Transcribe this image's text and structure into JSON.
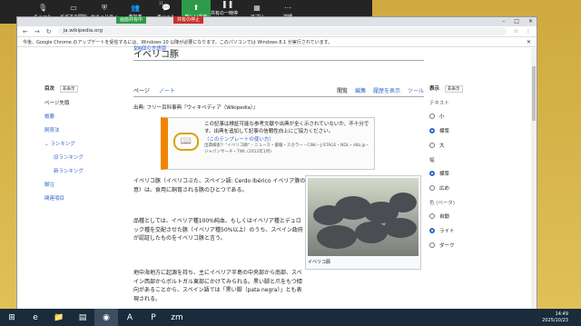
{
  "zoom": {
    "items": [
      {
        "label": "ミュート",
        "icon": "microphone-icon"
      },
      {
        "label": "ビデオの開始",
        "icon": "video-icon"
      },
      {
        "label": "セキュリティ",
        "icon": "shield-icon"
      },
      {
        "label": "参加者",
        "icon": "participants-icon",
        "count": "11"
      },
      {
        "label": "チャット",
        "icon": "chat-icon"
      },
      {
        "label": "新しい共有",
        "icon": "share-icon"
      },
      {
        "label": "共有の一時停止",
        "icon": "pause-icon"
      },
      {
        "label": "アプリ",
        "icon": "apps-icon"
      },
      {
        "label": "詳細",
        "icon": "more-icon"
      }
    ],
    "sharing_text": "画面共有中",
    "stop_text": "共有の停止"
  },
  "browser": {
    "url": "ja.wikipedia.org",
    "infobar": "今後、Google Chrome のアップデートを受信するには、Windows 10 以降が必要になります。このパソコンでは Windows 8.1 が実行されています。"
  },
  "article": {
    "title": "イベリコ豚",
    "langs": "17 個の言語版",
    "toc_title": "目次",
    "hide": "非表示",
    "toc": [
      {
        "label": "ページ先頭",
        "level": "top"
      },
      {
        "label": "概要",
        "level": "1"
      },
      {
        "label": "飼育法",
        "level": "1"
      },
      {
        "label": "ランキング",
        "level": "1"
      },
      {
        "label": "旧ランキング",
        "level": "2"
      },
      {
        "label": "新ランキング",
        "level": "2"
      },
      {
        "label": "脚注",
        "level": "1"
      },
      {
        "label": "関連項目",
        "level": "1"
      }
    ],
    "tab_page": "ページ",
    "tab_talk": "ノート",
    "tab_read": "閲覧",
    "tab_edit": "編集",
    "tab_history": "履歴を表示",
    "tab_tools": "ツール",
    "from": "出典: フリー百科事典『ウィキペディア（Wikipedia）』",
    "ambox_main": "この記事は検証可能な参考文献や出典が全く示されていないか、不十分です。出典を追加して記事の信頼性向上にご協力ください。",
    "ambox_how": "（このテンプレートの使い方）",
    "ambox_src": "出典検索?: \"イベリコ豚\" – ニュース・書籍・スカラー・CiNii・J-STAGE・NDL・dlib.jp・ジャパンサーチ・TWL (2012年1月)",
    "para1": "イベリコ豚（イベリコぶた、スペイン語: Cerdo Ibérico イベリア豚の意）は、食用に飼育される豚のひとつである。",
    "para2": "品種としては、イベリア種100%純血、もしくはイベリア種とデュロック種を交配させた豚（イベリア種50%以上）のうち、スペイン政府が認証したものをイベリコ豚と言う。",
    "para3": "地中海地方に起源を持ち、主にイベリア半島の中央部から南部、スペイン西部からポルトガル東部にかけてみられる。黒い脚と爪をもつ傾向があることから、スペイン語では「黒い脚（pata negra）」とも表現される。",
    "caption": "イベリコ豚"
  },
  "appearance": {
    "title": "表示",
    "hide": "非表示",
    "text_heading": "テキスト",
    "text_options": [
      "小",
      "標準",
      "大"
    ],
    "width_heading": "幅",
    "width_options": [
      "標準",
      "広め"
    ],
    "color_heading": "色 (ベータ)",
    "color_options": [
      "自動",
      "ライト",
      "ダーク"
    ]
  },
  "taskbar": {
    "time": "14:49",
    "date": "2025/10/23"
  }
}
